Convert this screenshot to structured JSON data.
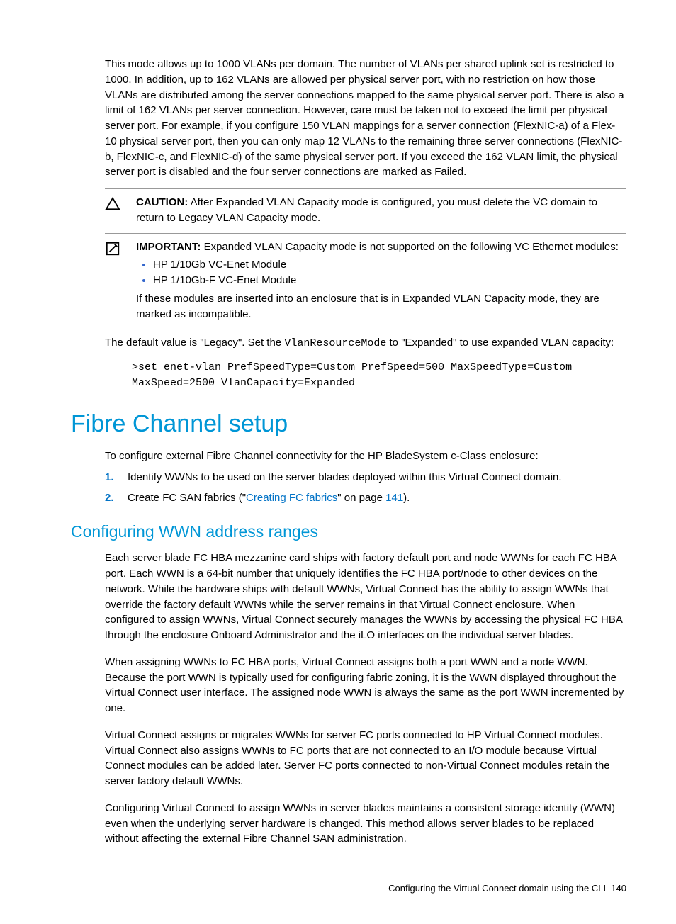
{
  "intro_para": "This mode allows up to 1000 VLANs per domain. The number of VLANs per shared uplink set is restricted to 1000. In addition, up to 162 VLANs are allowed per physical server port, with no restriction on how those VLANs are distributed among the server connections mapped to the same physical server port. There is also a limit of 162 VLANs per server connection. However, care must be taken not to exceed the limit per physical server port. For example, if you configure 150 VLAN mappings for a server connection (FlexNIC-a) of a Flex-10 physical server port, then you can only map 12 VLANs to the remaining three server connections (FlexNIC-b, FlexNIC-c, and FlexNIC-d) of the same physical server port. If you exceed the 162 VLAN limit, the physical server port is disabled and the four server connections are marked as Failed.",
  "caution": {
    "label": "CAUTION:",
    "text": "After Expanded VLAN Capacity mode is configured, you must delete the VC domain to return to Legacy VLAN Capacity mode."
  },
  "important": {
    "label": "IMPORTANT:",
    "lead": "Expanded VLAN Capacity mode is not supported on the following VC Ethernet modules:",
    "items": [
      "HP 1/10Gb VC-Enet Module",
      "HP 1/10Gb-F VC-Enet Module"
    ],
    "tail": "If these modules are inserted into an enclosure that is in Expanded VLAN Capacity mode, they are marked as incompatible."
  },
  "default_sentence": {
    "pre": "The default value is \"Legacy\". Set the ",
    "code": "VlanResourceMode",
    "post": " to \"Expanded\" to use expanded VLAN capacity:"
  },
  "codeblock": ">set enet-vlan PrefSpeedType=Custom PrefSpeed=500 MaxSpeedType=Custom MaxSpeed=2500 VlanCapacity=Expanded",
  "fc": {
    "heading": "Fibre Channel setup",
    "intro": "To configure external Fibre Channel connectivity for the HP BladeSystem c-Class enclosure:",
    "steps": [
      {
        "num": "1.",
        "text": "Identify WWNs to be used on the server blades deployed within this Virtual Connect domain."
      },
      {
        "num": "2.",
        "pre": "Create FC SAN fabrics (\"",
        "link": "Creating FC fabrics",
        "mid": "\" on page ",
        "page": "141",
        "post": ")."
      }
    ]
  },
  "wwn": {
    "heading": "Configuring WWN address ranges",
    "paras": [
      "Each server blade FC HBA mezzanine card ships with factory default port and node WWNs for each FC HBA port. Each WWN is a 64-bit number that uniquely identifies the FC HBA port/node to other devices on the network. While the hardware ships with default WWNs, Virtual Connect has the ability to assign WWNs that override the factory default WWNs while the server remains in that Virtual Connect enclosure. When configured to assign WWNs, Virtual Connect securely manages the WWNs by accessing the physical FC HBA through the enclosure Onboard Administrator and the iLO interfaces on the individual server blades.",
      "When assigning WWNs to FC HBA ports, Virtual Connect assigns both a port WWN and a node WWN. Because the port WWN is typically used for configuring fabric zoning, it is the WWN displayed throughout the Virtual Connect user interface. The assigned node WWN is always the same as the port WWN incremented by one.",
      "Virtual Connect assigns or migrates WWNs for server FC ports connected to HP Virtual Connect modules. Virtual Connect also assigns WWNs to FC ports that are not connected to an I/O module because Virtual Connect modules can be added later. Server FC ports connected to non-Virtual Connect modules retain the server factory default WWNs.",
      "Configuring Virtual Connect to assign WWNs in server blades maintains a consistent storage identity (WWN) even when the underlying server hardware is changed. This method allows server blades to be replaced without affecting the external Fibre Channel SAN administration."
    ]
  },
  "footer": {
    "text": "Configuring the Virtual Connect domain using the CLI",
    "page": "140"
  }
}
